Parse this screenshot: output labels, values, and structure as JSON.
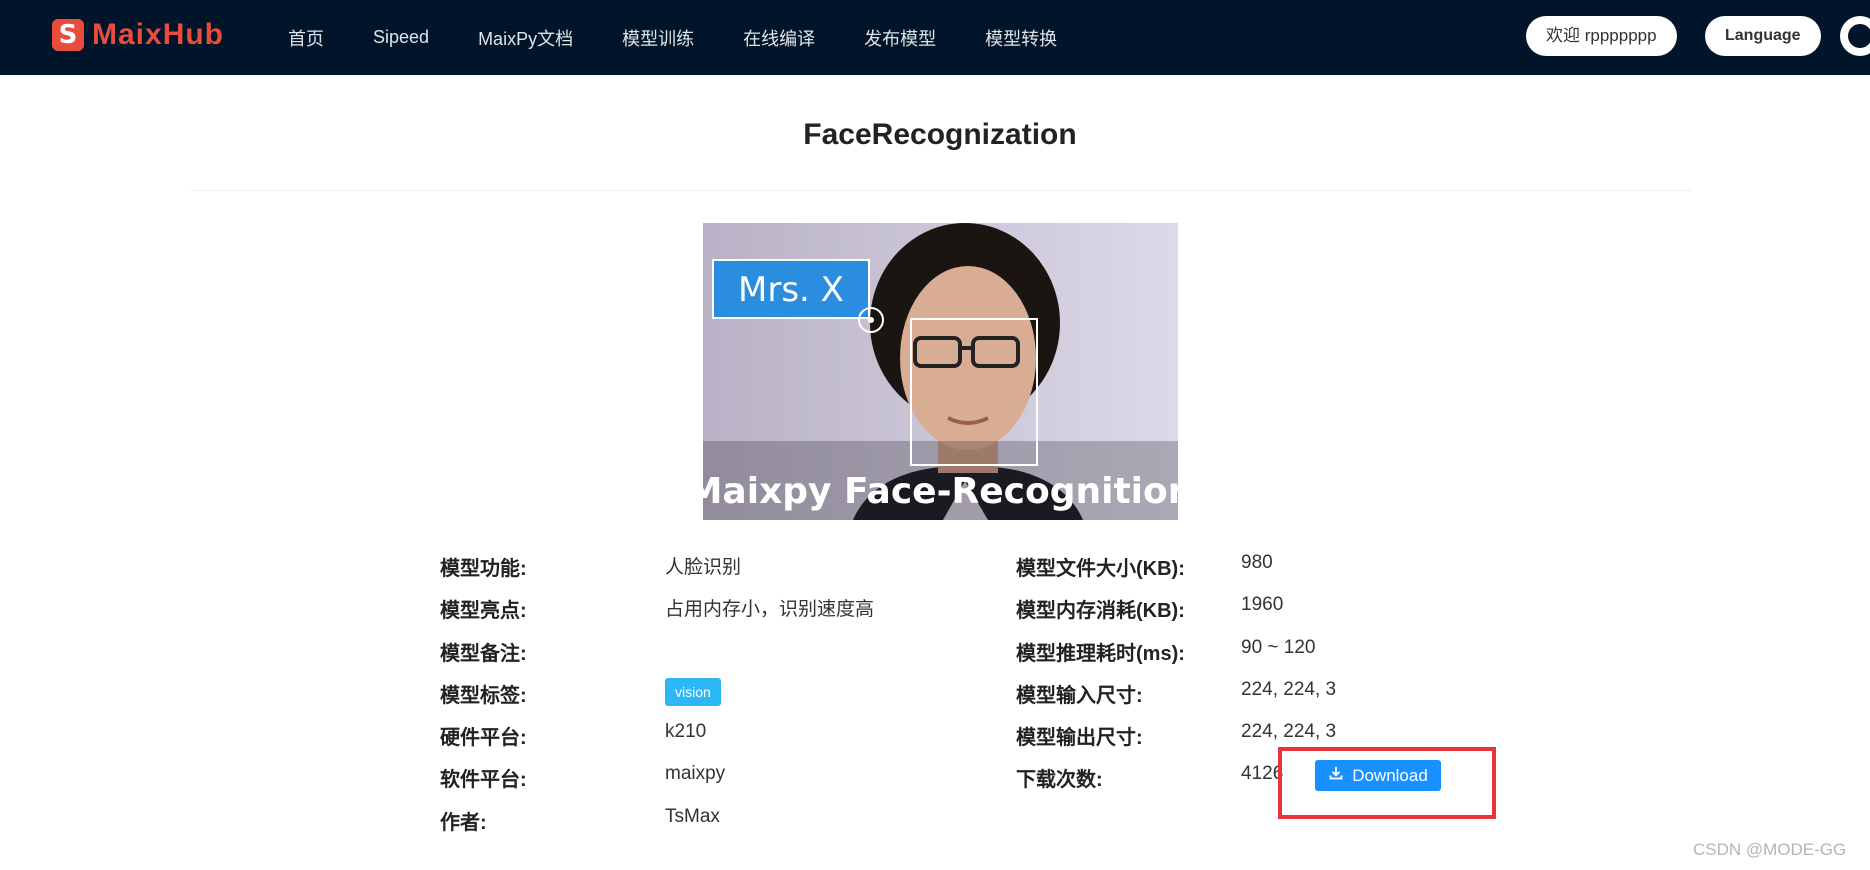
{
  "navbar": {
    "logo_text": "MaixHub",
    "logo_mark": "S",
    "menu": [
      "首页",
      "Sipeed",
      "MaixPy文档",
      "模型训练",
      "在线编译",
      "发布模型",
      "模型转换"
    ],
    "welcome": "欢迎 rppppppp",
    "language": "Language",
    "github_icon": "github-icon"
  },
  "page": {
    "title": "FaceRecognization"
  },
  "hero": {
    "label_text": "Mrs. X",
    "caption_text": "Maixpy Face-Recognition"
  },
  "left_info": [
    {
      "label": "模型功能:",
      "value": "人脸识别"
    },
    {
      "label": "模型亮点:",
      "value": "占用内存小，识别速度高"
    },
    {
      "label": "模型备注:",
      "value": ""
    },
    {
      "label": "模型标签:",
      "value": "vision"
    },
    {
      "label": "硬件平台:",
      "value": "k210"
    },
    {
      "label": "软件平台:",
      "value": "maixpy"
    },
    {
      "label": "作者:",
      "value": "TsMax"
    }
  ],
  "right_info": [
    {
      "label": "模型文件大小(KB):",
      "value": "980"
    },
    {
      "label": "模型内存消耗(KB):",
      "value": "1960"
    },
    {
      "label": "模型推理耗时(ms):",
      "value": "90 ~ 120"
    },
    {
      "label": "模型输入尺寸:",
      "value": "224, 224, 3"
    },
    {
      "label": "模型输出尺寸:",
      "value": "224, 224, 3"
    },
    {
      "label": "下载次数:",
      "value": "4126"
    }
  ],
  "download": {
    "label": "Download",
    "icon": "download-icon"
  },
  "watermark": "CSDN @MODE-GG",
  "colors": {
    "navbar_bg": "#001529",
    "brand": "#e74c3c",
    "tag": "#2db7f5",
    "primary": "#1890ff",
    "highlight": "#e8343b"
  }
}
